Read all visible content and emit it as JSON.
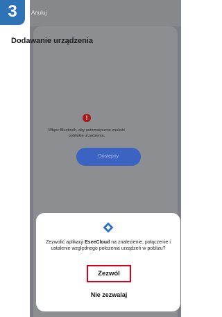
{
  "step_badge": "3",
  "header": {
    "cancel_label": "Anuluj"
  },
  "page": {
    "title": "Dodawanie urządzenia",
    "bluetooth_message": "Włącz Bluetooth, aby automatycznie znaleźć pobliskie urządzenia.",
    "available_button": "Dostępny"
  },
  "permission_dialog": {
    "message_before": "Zezwolić aplikacji ",
    "app_name": "EseeCloud",
    "message_after": " na znalezienie, połączenie i ustalenie względnego położenia urządzeń w pobliżu?",
    "allow_label": "Zezwól",
    "deny_label": "Nie zezwalaj"
  },
  "colors": {
    "badge": "#2d73b5",
    "highlight_border": "#d9001b",
    "accent_button": "#3b63c2",
    "warning": "#a61c1c",
    "permission_icon": "#2f6fcf"
  },
  "icons": {
    "warning": "exclamation-circle-icon",
    "permission": "nearby-devices-icon"
  }
}
